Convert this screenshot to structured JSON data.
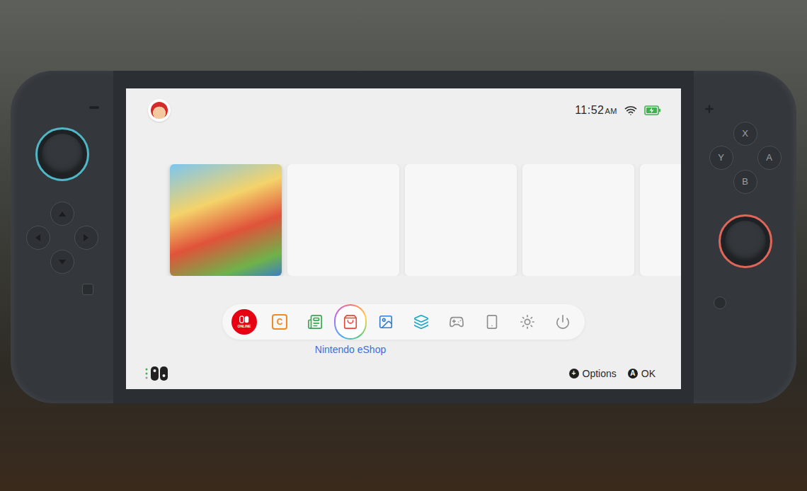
{
  "status_bar": {
    "time": "11:52",
    "meridiem": "AM",
    "battery": {
      "level": 1,
      "charging": true
    }
  },
  "tiles": [
    {
      "kind": "game"
    },
    {
      "kind": "empty"
    },
    {
      "kind": "empty"
    },
    {
      "kind": "empty"
    },
    {
      "kind": "empty"
    }
  ],
  "dock": [
    {
      "kind": "badge",
      "glyph": "ONLINE",
      "color": "#e60012",
      "selected": false
    },
    {
      "kind": "letter",
      "glyph": "C",
      "color": "#f08a24",
      "selected": false
    },
    {
      "kind": "icon",
      "color": "#3aa655",
      "selected": false
    },
    {
      "kind": "icon",
      "color": "#e5483a",
      "selected": true,
      "label": "Nintendo eShop"
    },
    {
      "kind": "icon",
      "color": "#2f7fd6",
      "selected": false
    },
    {
      "kind": "icon",
      "color": "#1aa7c9",
      "selected": false
    },
    {
      "kind": "icon",
      "color": "#8e8e8e",
      "selected": false
    },
    {
      "kind": "icon",
      "color": "#8e8e8e",
      "selected": false
    },
    {
      "kind": "icon",
      "color": "#8e8e8e",
      "selected": false
    },
    {
      "kind": "icon",
      "color": "#8e8e8e",
      "selected": false
    }
  ],
  "hints": [
    {
      "key": "+",
      "label": "Options"
    },
    {
      "key": "A",
      "label": "OK"
    }
  ],
  "face_buttons": [
    {
      "label": "X"
    },
    {
      "label": "Y"
    },
    {
      "label": "A"
    },
    {
      "label": "B"
    }
  ]
}
